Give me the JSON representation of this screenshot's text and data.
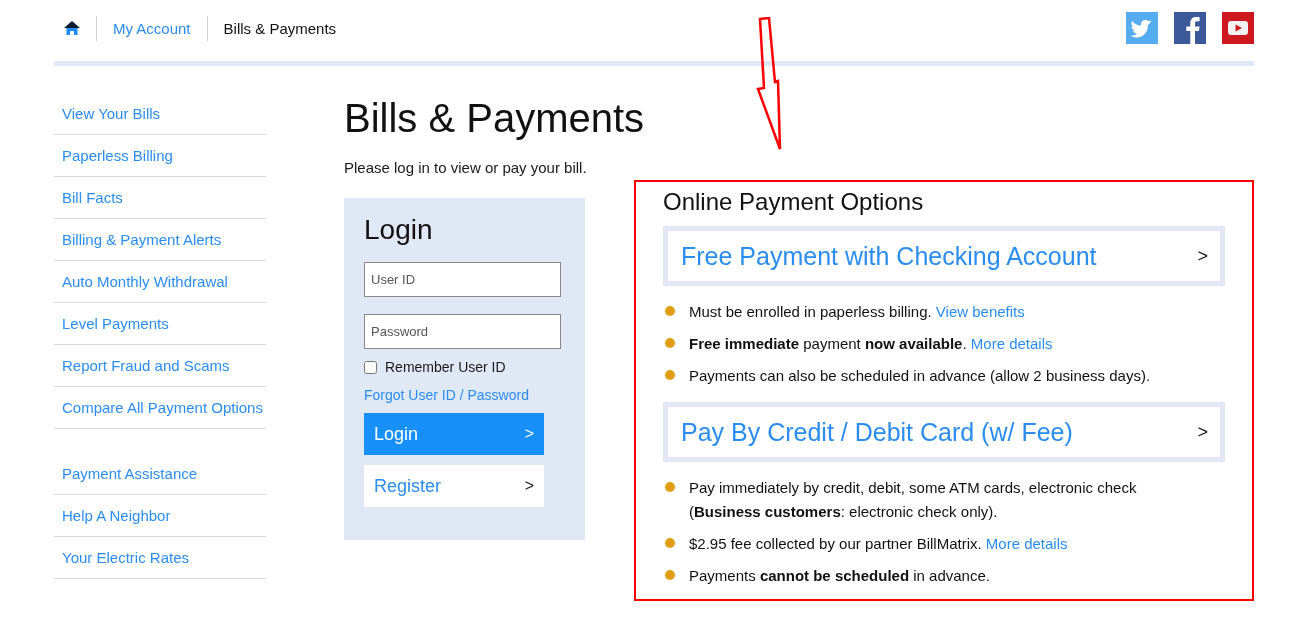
{
  "breadcrumb": {
    "items": [
      {
        "label": "My Account",
        "link": true
      },
      {
        "label": "Bills & Payments",
        "link": false
      }
    ]
  },
  "social": [
    {
      "kind": "twitter"
    },
    {
      "kind": "facebook"
    },
    {
      "kind": "youtube"
    }
  ],
  "sidebar": {
    "groups": [
      {
        "items": [
          "View Your Bills",
          "Paperless Billing",
          "Bill Facts",
          "Billing & Payment Alerts",
          "Auto Monthly Withdrawal",
          "Level Payments",
          "Report Fraud and Scams",
          "Compare All Payment Options"
        ]
      },
      {
        "items": [
          "Payment Assistance",
          "Help A Neighbor",
          "Your Electric Rates"
        ]
      }
    ]
  },
  "page": {
    "title": "Bills & Payments",
    "intro": "Please log in to view or pay your bill."
  },
  "login": {
    "title": "Login",
    "fields": [
      {
        "placeholder": "User ID"
      },
      {
        "placeholder": "Password"
      }
    ],
    "remember": {
      "label": "Remember User ID",
      "checked": false
    },
    "forgot": "Forgot User ID / Password",
    "buttons": [
      {
        "label": "Login",
        "kind": "primary",
        "chevron": ">"
      },
      {
        "label": "Register",
        "kind": "secondary",
        "chevron": ">"
      }
    ]
  },
  "options": {
    "title": "Online Payment Options",
    "sections": [
      {
        "heading": "Free Payment with Checking Account",
        "chevron": ">",
        "bullets": [
          {
            "text": "Must be enrolled in paperless billing.",
            "link": "View benefits"
          },
          {
            "text": "**Free immediate** payment **now available**.",
            "link": "More details"
          },
          {
            "text": "Payments can also be scheduled in advance (allow 2 business days)."
          }
        ]
      },
      {
        "heading": "Pay By Credit / Debit Card (w/ Fee)",
        "chevron": ">",
        "bullets": [
          {
            "text": "Pay immediately by credit, debit, some ATM cards, electronic check (**Business customers**: electronic check only)."
          },
          {
            "text": "$2.95 fee collected by our partner BillMatrix.",
            "link": "More details"
          },
          {
            "text": "Payments **cannot be scheduled** in advance."
          }
        ]
      }
    ]
  }
}
